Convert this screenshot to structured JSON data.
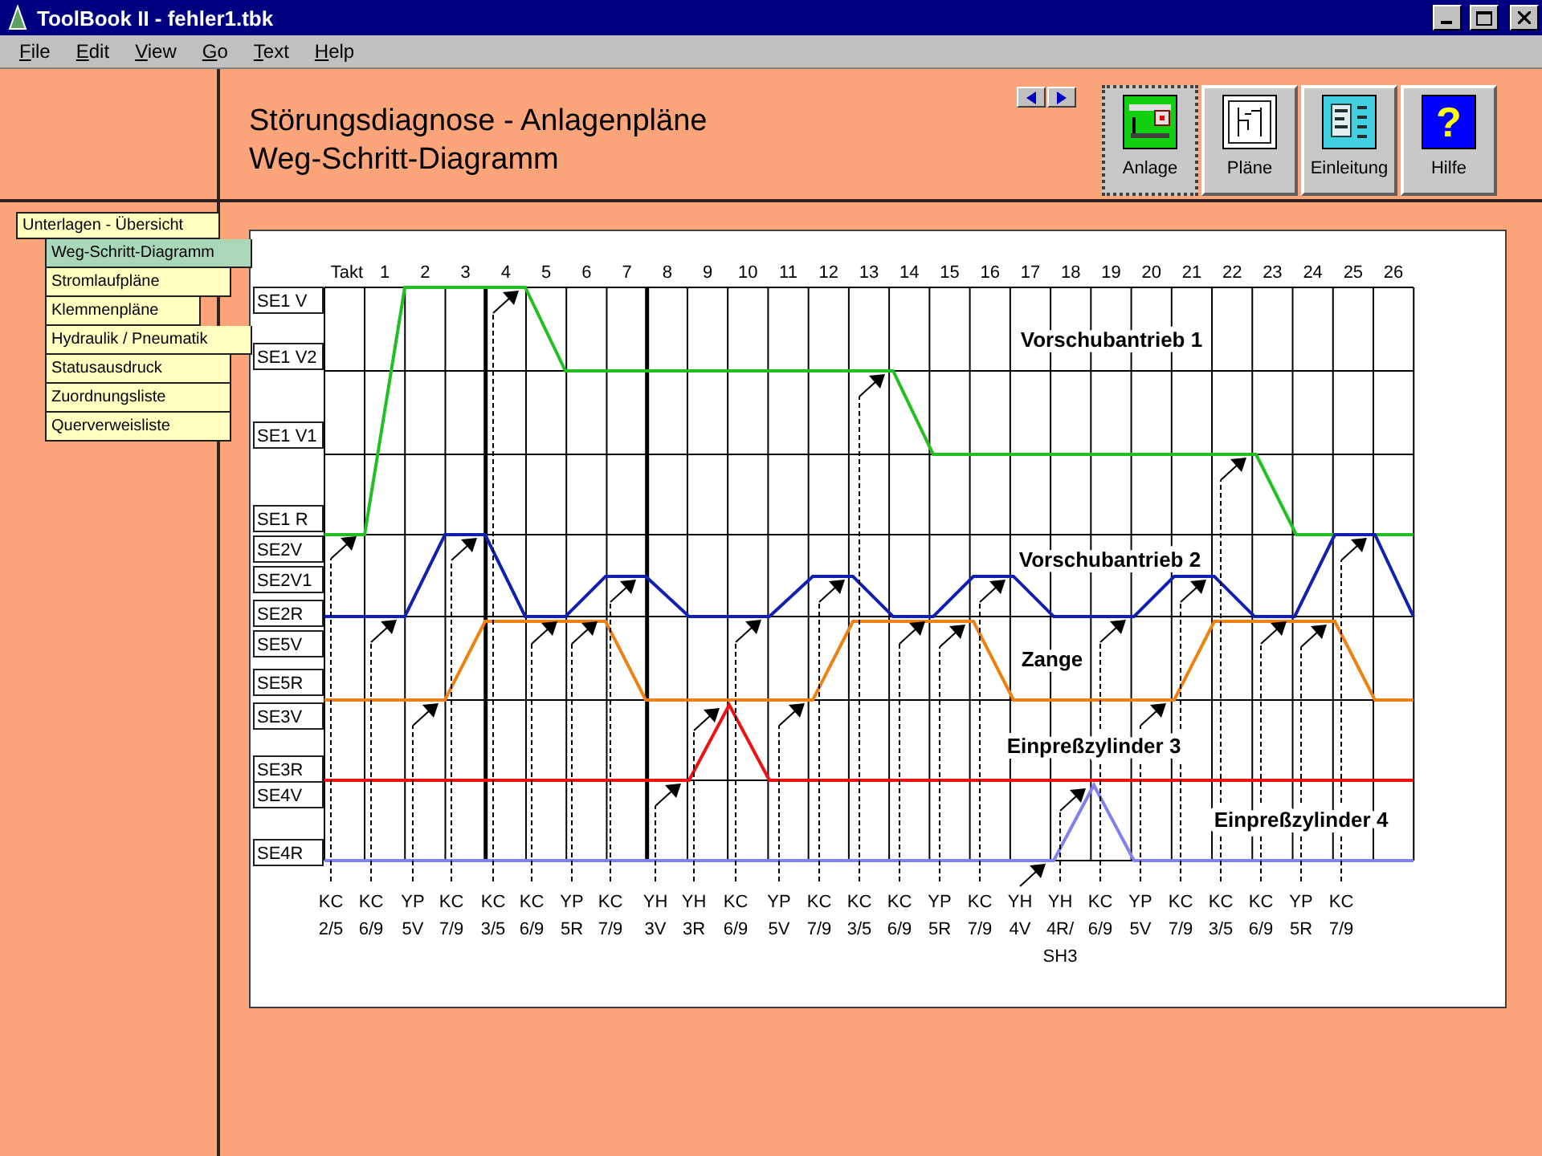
{
  "window": {
    "title": "ToolBook II - fehler1.tbk"
  },
  "menu": [
    "File",
    "Edit",
    "View",
    "Go",
    "Text",
    "Help"
  ],
  "header": {
    "title": "Störungsdiagnose - Anlagenpläne",
    "subtitle": "Weg-Schritt-Diagramm"
  },
  "toolbar": [
    {
      "label": "Anlage",
      "kind": "plant",
      "selected": true
    },
    {
      "label": "Pläne",
      "kind": "plans",
      "selected": false
    },
    {
      "label": "Einleitung",
      "kind": "intro",
      "selected": false
    },
    {
      "label": "Hilfe",
      "kind": "help",
      "glyph": "?",
      "selected": false
    }
  ],
  "nav": {
    "title": "Unterlagen - Übersicht",
    "items": [
      {
        "label": "Weg-Schritt-Diagramm",
        "selected": true
      },
      {
        "label": "Stromlaufpläne",
        "selected": false
      },
      {
        "label": "Klemmenpläne",
        "selected": false
      },
      {
        "label": "Hydraulik / Pneumatik",
        "selected": false
      },
      {
        "label": "Statusausdruck",
        "selected": false
      },
      {
        "label": "Zuordnungsliste",
        "selected": false
      },
      {
        "label": "Querverweisliste",
        "selected": false
      }
    ]
  },
  "diagram": {
    "takt_label": "Takt",
    "steps": [
      "1",
      "2",
      "3",
      "4",
      "5",
      "6",
      "7",
      "8",
      "9",
      "10",
      "11",
      "12",
      "13",
      "14",
      "15",
      "16",
      "17",
      "18",
      "19",
      "20",
      "21",
      "22",
      "23",
      "24",
      "25",
      "26"
    ],
    "rows": [
      "SE1 V",
      "SE1 V2",
      "SE1 V1",
      "SE1 R",
      "SE2V",
      "SE2V1",
      "SE2R",
      "SE5V",
      "SE5R",
      "SE3V",
      "SE3R",
      "SE4V",
      "SE4R"
    ],
    "traces": [
      {
        "name": "Vorschubantrieb 1",
        "color": "#20c020"
      },
      {
        "name": "Vorschubantrieb 2",
        "color": "#1020b0"
      },
      {
        "name": "Zange",
        "color": "#f08010"
      },
      {
        "name": "Einpreßzylinder 3",
        "color": "#f01010"
      },
      {
        "name": "Einpreßzylinder 4",
        "color": "#8080f0"
      }
    ],
    "signals": [
      {
        "lines": [
          "KC",
          "2/5"
        ]
      },
      {
        "lines": [
          "KC",
          "6/9"
        ]
      },
      {
        "lines": [
          "YP",
          "5V"
        ]
      },
      {
        "lines": [
          "KC",
          "7/9"
        ]
      },
      {
        "lines": [
          "KC",
          "3/5"
        ]
      },
      {
        "lines": [
          "KC",
          "6/9"
        ]
      },
      {
        "lines": [
          "YP",
          "5R"
        ]
      },
      {
        "lines": [
          "KC",
          "7/9"
        ]
      },
      {
        "lines": [
          "YH",
          "3V"
        ]
      },
      {
        "lines": [
          "YH",
          "3R"
        ]
      },
      {
        "lines": [
          "KC",
          "6/9"
        ]
      },
      {
        "lines": [
          "YP",
          "5V"
        ]
      },
      {
        "lines": [
          "KC",
          "7/9"
        ]
      },
      {
        "lines": [
          "KC",
          "3/5"
        ]
      },
      {
        "lines": [
          "KC",
          "6/9"
        ]
      },
      {
        "lines": [
          "YP",
          "5R"
        ]
      },
      {
        "lines": [
          "KC",
          "7/9"
        ]
      },
      {
        "lines": [
          "YH",
          "4V"
        ]
      },
      {
        "lines": [
          "YH",
          "4R/",
          "SH3"
        ]
      },
      {
        "lines": [
          "KC",
          "6/9"
        ]
      },
      {
        "lines": [
          "YP",
          "5V"
        ]
      },
      {
        "lines": [
          "KC",
          "7/9"
        ]
      },
      {
        "lines": [
          "KC",
          "3/5"
        ]
      },
      {
        "lines": [
          "KC",
          "6/9"
        ]
      },
      {
        "lines": [
          "YP",
          "5R"
        ]
      },
      {
        "lines": [
          "KC",
          "7/9"
        ]
      }
    ]
  }
}
